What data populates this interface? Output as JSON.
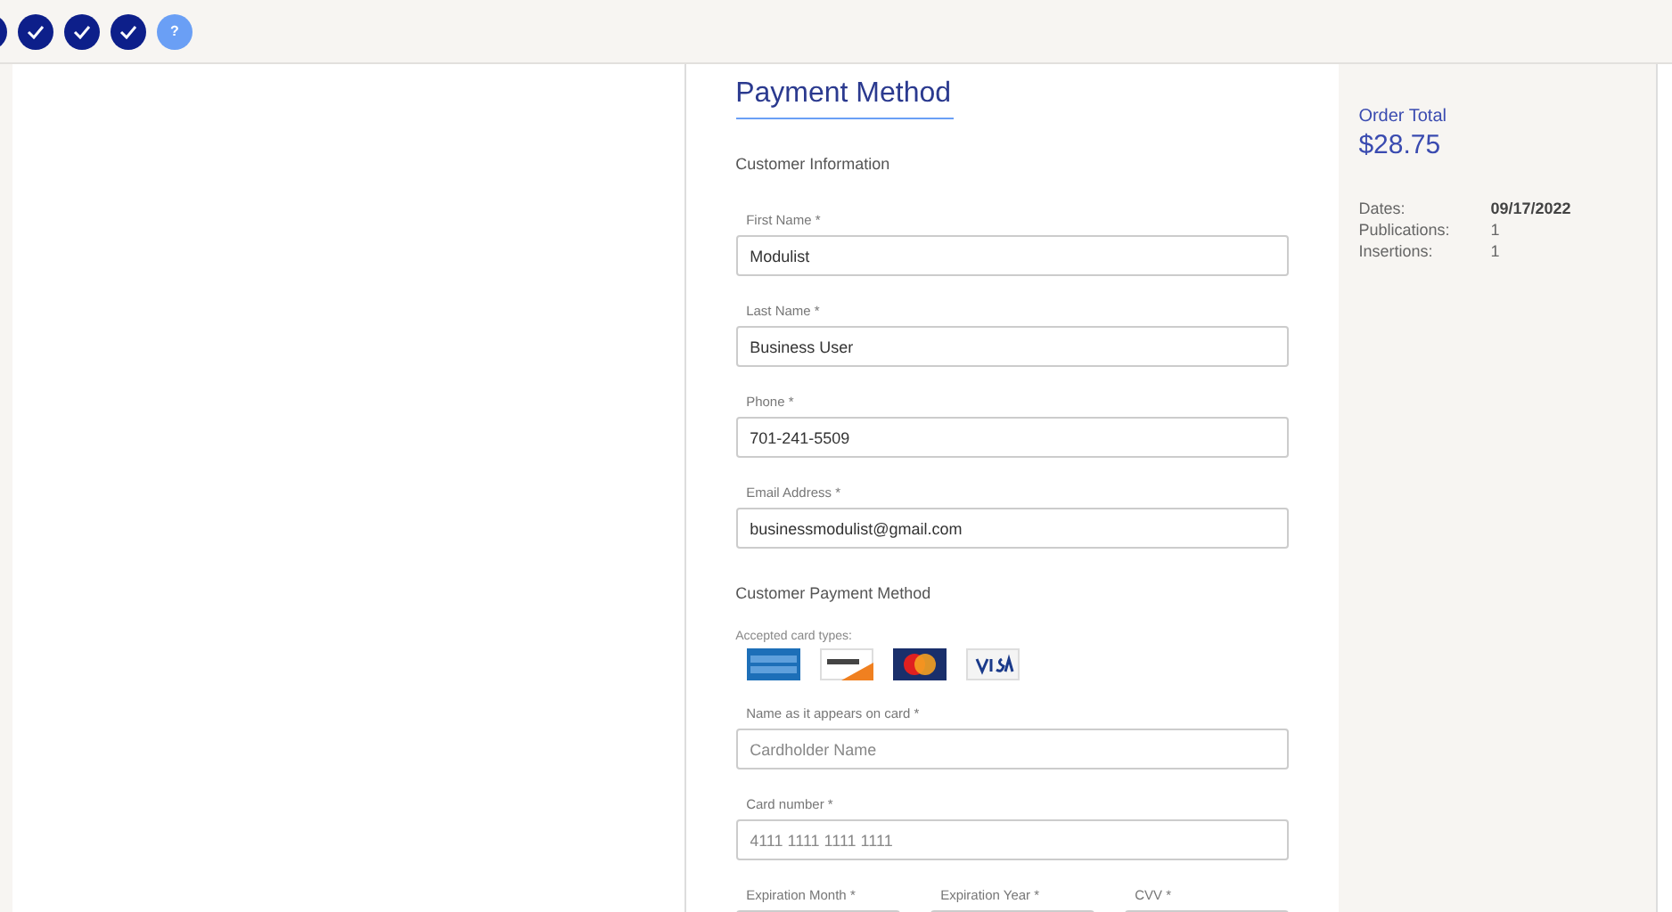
{
  "steps": [
    {
      "done": true
    },
    {
      "done": true
    },
    {
      "done": true
    },
    {
      "done": true
    },
    {
      "done": false,
      "label": "?"
    }
  ],
  "form": {
    "title": "Payment Method",
    "customer_section": "Customer Information",
    "customer_fields": [
      {
        "label": "First Name *",
        "value": "Modulist"
      },
      {
        "label": "Last Name *",
        "value": "Business User"
      },
      {
        "label": "Phone *",
        "value": "701-241-5509"
      },
      {
        "label": "Email Address *",
        "value": "businessmodulist@gmail.com"
      }
    ],
    "payment_section": "Customer Payment Method",
    "accepted_label": "Accepted card types:",
    "card_types": [
      {
        "kind": "amex"
      },
      {
        "kind": "discover"
      },
      {
        "kind": "mastercard"
      },
      {
        "kind": "visa"
      }
    ],
    "card_fields": [
      {
        "label": "Name as it appears on card *",
        "placeholder": "Cardholder Name"
      },
      {
        "label": "Card number *",
        "placeholder": "4111 1111 1111 1111"
      }
    ],
    "expiry_fields": [
      {
        "label": "Expiration Month *"
      },
      {
        "label": "Expiration Year *"
      },
      {
        "label": "CVV *"
      }
    ]
  },
  "summary": {
    "total_label": "Order Total",
    "total": "$28.75",
    "rows": [
      {
        "label": "Dates:",
        "value": "09/17/2022",
        "bold": true
      },
      {
        "label": "Publications:",
        "value": "1",
        "bold": false
      },
      {
        "label": "Insertions:",
        "value": "1",
        "bold": false
      }
    ]
  }
}
